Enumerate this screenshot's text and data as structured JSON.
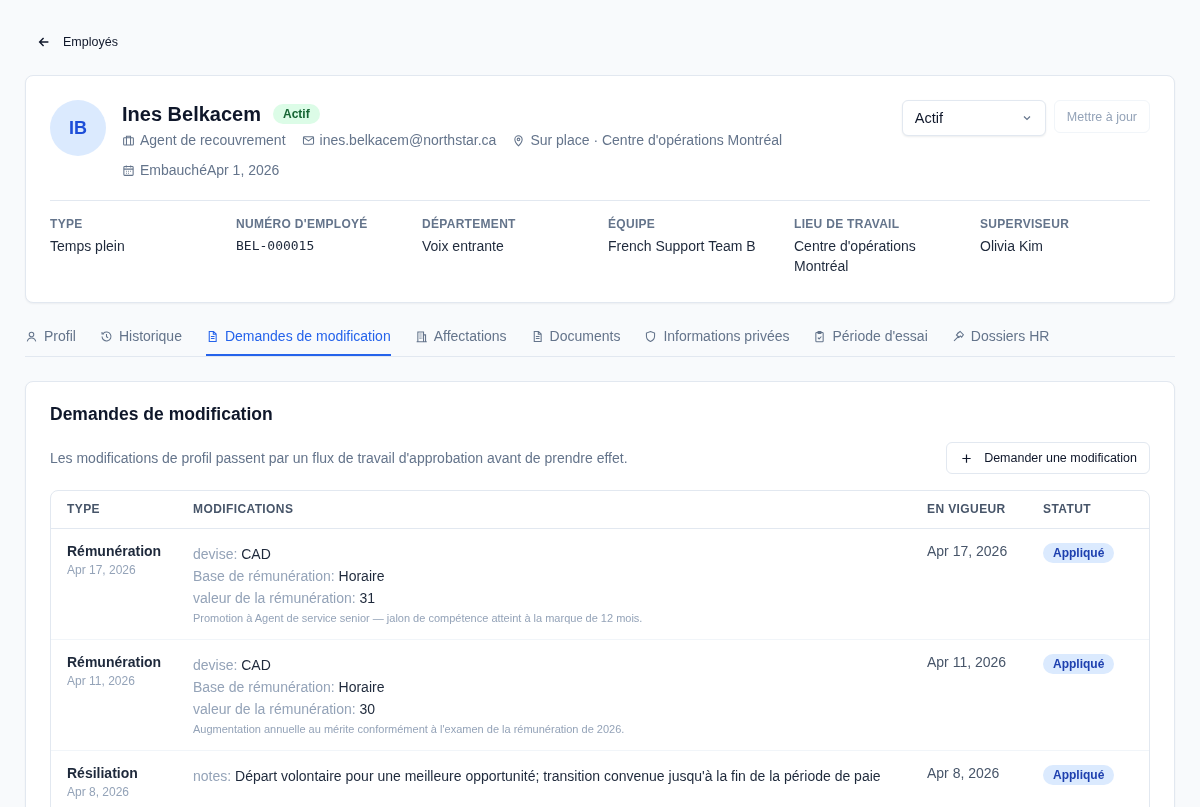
{
  "back_link": {
    "label": "Employés"
  },
  "employee": {
    "initials": "IB",
    "name": "Ines Belkacem",
    "status_badge": {
      "label": "Actif",
      "kind": "success"
    },
    "meta": [
      {
        "kind": "job",
        "text": "Agent de recouvrement"
      },
      {
        "kind": "email",
        "text": "ines.belkacem@northstar.ca"
      },
      {
        "kind": "location",
        "text": "Sur place · Centre d'opérations Montréal"
      },
      {
        "kind": "date",
        "text": "EmbauchéApr 1, 2026"
      }
    ],
    "status_select": {
      "value": "Actif"
    },
    "update_button": {
      "label": "Mettre à jour",
      "disabled": true
    },
    "fields": [
      {
        "label": "TYPE",
        "value": "Temps plein",
        "kind": "text"
      },
      {
        "label": "NUMÉRO D'EMPLOYÉ",
        "value": "BEL-000015",
        "kind": "code"
      },
      {
        "label": "DÉPARTEMENT",
        "value": "Voix entrante",
        "kind": "text"
      },
      {
        "label": "ÉQUIPE",
        "value": "French Support Team B",
        "kind": "text"
      },
      {
        "label": "LIEU DE TRAVAIL",
        "value": "Centre d'opérations Montréal",
        "kind": "text"
      },
      {
        "label": "SUPERVISEUR",
        "value": "Olivia Kim",
        "kind": "text"
      }
    ]
  },
  "tabs": [
    {
      "label": "Profil",
      "selected": false
    },
    {
      "label": "Historique",
      "selected": false
    },
    {
      "label": "Demandes de modification",
      "selected": true
    },
    {
      "label": "Affectations",
      "selected": false
    },
    {
      "label": "Documents",
      "selected": false
    },
    {
      "label": "Informations privées",
      "selected": false
    },
    {
      "label": "Période d'essai",
      "selected": false
    },
    {
      "label": "Dossiers HR",
      "selected": false
    }
  ],
  "panel": {
    "title": "Demandes de modification",
    "description": "Les modifications de profil passent par un flux de travail d'approbation avant de prendre effet.",
    "request_button": {
      "label": "Demander une modification"
    },
    "table": {
      "columns": [
        "TYPE",
        "MODIFICATIONS",
        "EN VIGUEUR",
        "STATUT"
      ],
      "rows": [
        {
          "type": "Rémunération",
          "date": "Apr 17, 2026",
          "changes": [
            {
              "label": "devise:",
              "value": "CAD"
            },
            {
              "label": "Base de rémunération:",
              "value": "Horaire"
            },
            {
              "label": "valeur de la rémunération:",
              "value": "31"
            }
          ],
          "note": "Promotion à Agent de service senior — jalon de compétence atteint à la marque de 12 mois.",
          "effective": "Apr 17, 2026",
          "status": {
            "label": "Appliqué",
            "kind": "applied"
          }
        },
        {
          "type": "Rémunération",
          "date": "Apr 11, 2026",
          "changes": [
            {
              "label": "devise:",
              "value": "CAD"
            },
            {
              "label": "Base de rémunération:",
              "value": "Horaire"
            },
            {
              "label": "valeur de la rémunération:",
              "value": "30"
            }
          ],
          "note": "Augmentation annuelle au mérite conformément à l'examen de la rémunération de 2026.",
          "effective": "Apr 11, 2026",
          "status": {
            "label": "Appliqué",
            "kind": "applied"
          }
        },
        {
          "type": "Résiliation",
          "date": "Apr 8, 2026",
          "changes": [
            {
              "label": "notes:",
              "value": "Départ volontaire pour une meilleure opportunité; transition convenue jusqu'à la fin de la période de paie"
            }
          ],
          "effective": "Apr 8, 2026",
          "status": {
            "label": "Appliqué",
            "kind": "applied"
          }
        }
      ]
    }
  }
}
